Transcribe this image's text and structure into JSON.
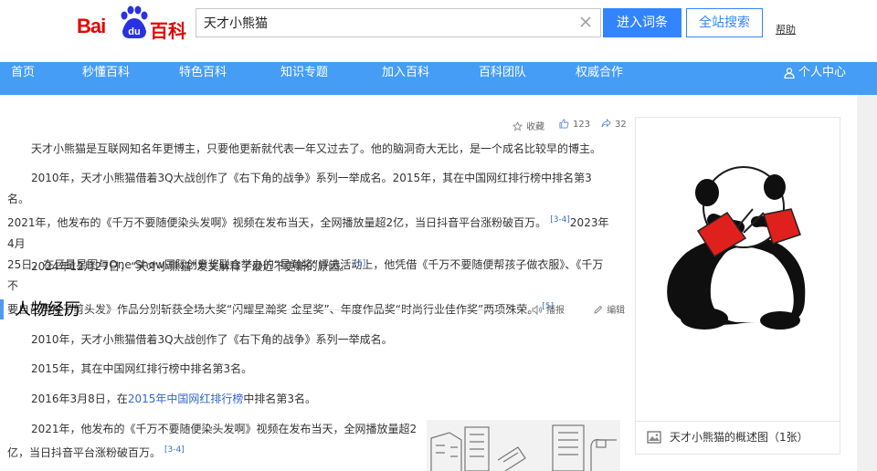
{
  "header": {
    "logo_text_left": "Bai",
    "logo_text_paw": "du",
    "logo_text_right": "百科",
    "search_value": "天才小熊猫",
    "enter_button": "进入词条",
    "all_search_button": "全站搜索",
    "help_link": "帮助"
  },
  "nav": {
    "items": [
      "首页",
      "秒懂百科",
      "特色百科",
      "知识专题",
      "加入百科",
      "百科团队",
      "权威合作"
    ],
    "user_center": "个人中心"
  },
  "actions": {
    "favorite": "收藏",
    "like_count": "123",
    "share_count": "32"
  },
  "intro": {
    "p1": "天才小熊猫是互联网知名年更博主，只要他更新就代表一年又过去了。他的脑洞奇大无比，是一个成名比较早的博主。",
    "p2_a": "2010年，天才小熊猫借着3Q大战创作了《右下角的战争》系列一举成名。2015年，其在中国网红排行榜中排名第3名。",
    "p2_b": "2021年，他发布的《千万不要随便染头发啊》视频在发布当天，全网播放量超2亿，当日抖音平台涨粉破百万。",
    "p2_ref1": "[3-4]",
    "p2_c": "2023年4月",
    "p2_d": "25日，在巨量星图与One Show国际创意奖联合举办的“星瀚奖”评选活动上，他凭借《千万不要随便帮孩子做衣服》、《千万不",
    "p2_e": "要自己帮孩子剪头发》作品分别斩获全场大奖“闪耀星瀚奖-金星奖”、年度作品奖“时尚行业佳作奖”两项殊荣。",
    "p2_ref2": "[5]",
    "p3": "2024年12月27日，“天才小熊猫”发文解释了最近不更新的原因。",
    "p3_ref": "[6]"
  },
  "section": {
    "title": "人物经历",
    "tool_audio": "播报",
    "tool_edit": "编辑",
    "e1": "2010年，天才小熊猫借着3Q大战创作了《右下角的战争》系列一举成名。",
    "e2": "2015年，其在中国网红排行榜中排名第3名。",
    "e3_a": "2016年3月8日，在",
    "e3_link": "2015年中国网红排行榜",
    "e3_b": "中排名第3名。",
    "e4_a": "2021年，他发布的《千万不要随便染头发啊》视频在发布当天，全网播放量超2",
    "e4_b": "亿，当日抖音平台涨粉破百万。",
    "e4_ref": "[3-4]"
  },
  "panel": {
    "caption": "天才小熊猫的概述图（1张）"
  },
  "colors": {
    "nav_bg": "#459df5",
    "brand_red": "#e10602",
    "accent_blue": "#3385ff",
    "flag_red": "#e0201c"
  }
}
